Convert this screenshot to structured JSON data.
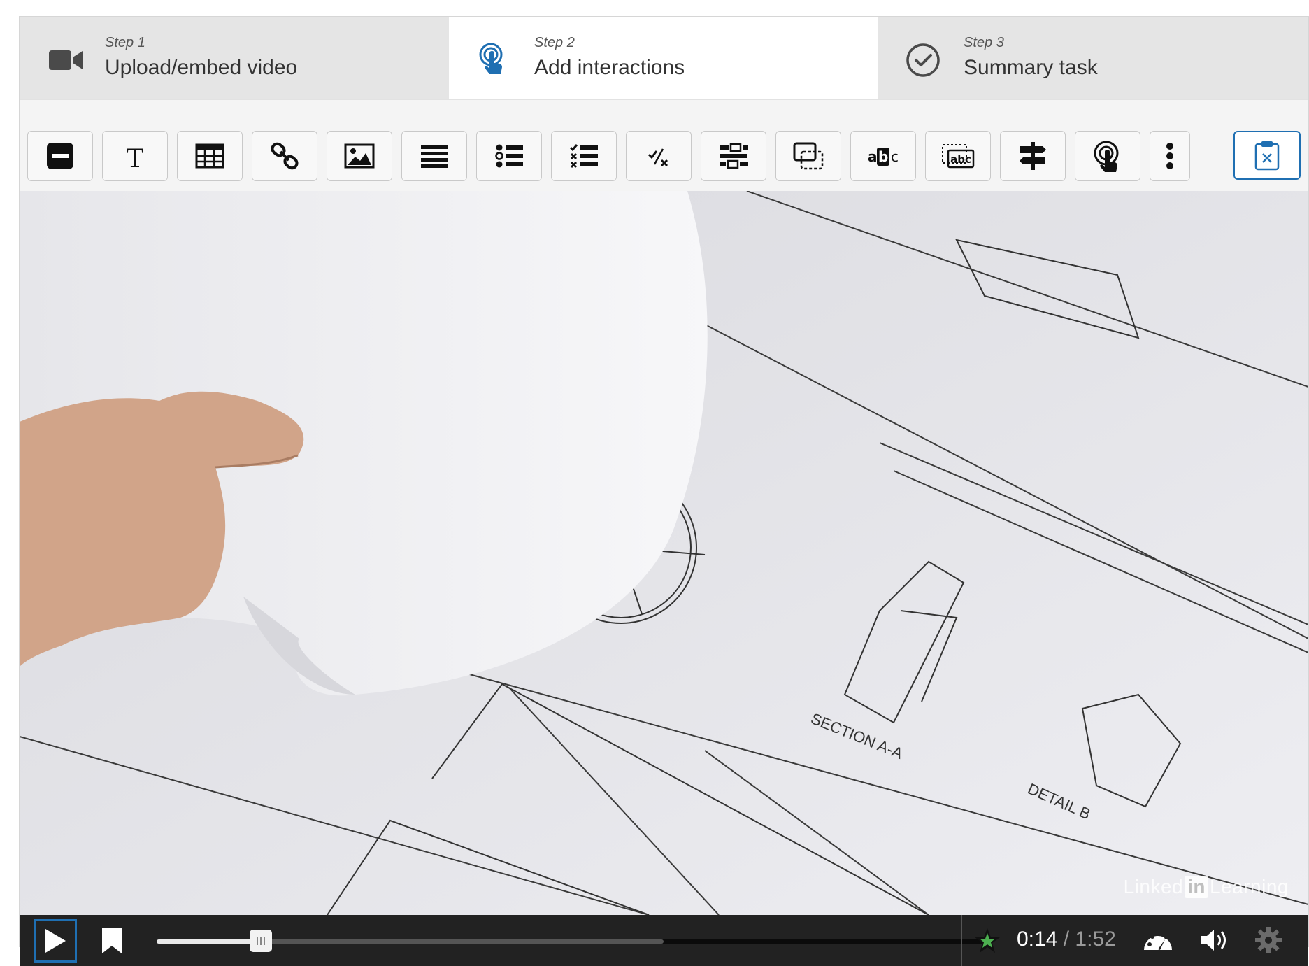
{
  "steps": [
    {
      "number": "Step 1",
      "title": "Upload/embed video",
      "icon": "video-camera-icon"
    },
    {
      "number": "Step 2",
      "title": "Add interactions",
      "icon": "touch-pointer-icon"
    },
    {
      "number": "Step 3",
      "title": "Summary task",
      "icon": "checkmark-circle-icon"
    }
  ],
  "active_step": 1,
  "toolbar": {
    "tools": [
      {
        "name": "label",
        "icon": "label-icon"
      },
      {
        "name": "text",
        "icon": "text-icon"
      },
      {
        "name": "table",
        "icon": "table-icon"
      },
      {
        "name": "link",
        "icon": "link-icon"
      },
      {
        "name": "image",
        "icon": "image-icon"
      },
      {
        "name": "statements",
        "icon": "statements-icon"
      },
      {
        "name": "single-choice-set",
        "icon": "single-choice-icon"
      },
      {
        "name": "multiple-choice",
        "icon": "multiple-choice-icon"
      },
      {
        "name": "true-false",
        "icon": "true-false-icon"
      },
      {
        "name": "fill-in-blanks",
        "icon": "fill-in-blanks-icon"
      },
      {
        "name": "drag-and-drop",
        "icon": "drag-and-drop-icon"
      },
      {
        "name": "mark-the-words",
        "icon": "mark-the-words-icon"
      },
      {
        "name": "drag-text",
        "icon": "drag-text-icon"
      },
      {
        "name": "crossroads",
        "icon": "signpost-icon"
      },
      {
        "name": "navigation-hotspot",
        "icon": "hotspot-icon"
      },
      {
        "name": "more",
        "icon": "more-vertical-icon"
      }
    ],
    "paste": {
      "icon": "paste-clipboard-icon"
    }
  },
  "video": {
    "watermark_brand": "Linked",
    "watermark_in": "in",
    "watermark_suffix": "Learning"
  },
  "player": {
    "current_time": "0:14",
    "separator": "/",
    "duration": "1:52",
    "played_fraction": 0.125,
    "buffered_fraction": 0.61,
    "marker_color": "#4caf50",
    "accent_color": "#1f6fb2"
  }
}
